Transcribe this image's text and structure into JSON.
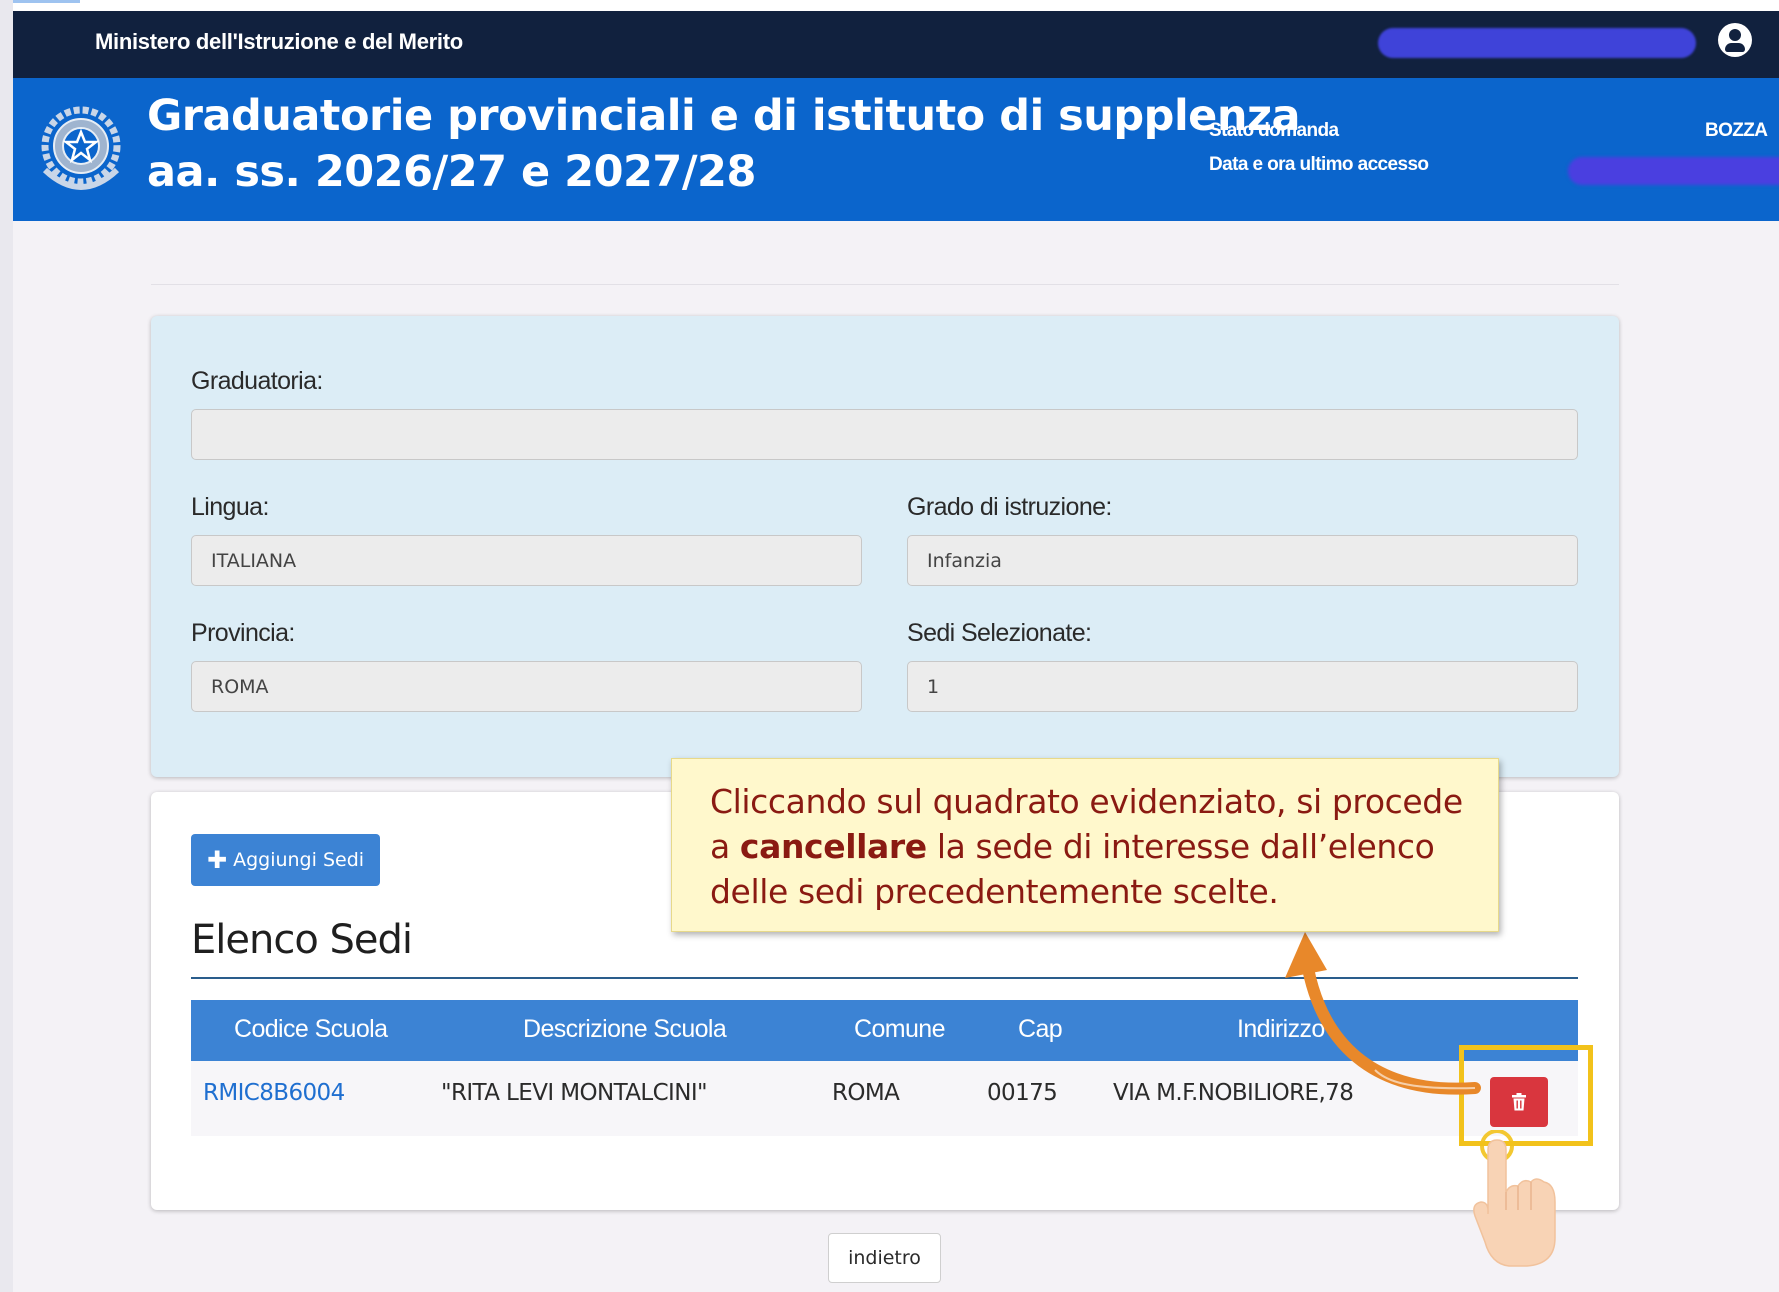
{
  "topbar": {
    "ministry": "Ministero dell'Istruzione e del Merito"
  },
  "header": {
    "title_line1": "Graduatorie provinciali e di istituto di supplenza",
    "title_line2": "aa. ss. 2026/27 e 2027/28",
    "stato_label": "Stato domanda",
    "stato_value": "BOZZA",
    "data_label": "Data e ora ultimo accesso"
  },
  "form": {
    "graduatoria_label": "Graduatoria:",
    "graduatoria_value": "",
    "lingua_label": "Lingua:",
    "lingua_value": "ITALIANA",
    "grado_label": "Grado di istruzione:",
    "grado_value": "Infanzia",
    "provincia_label": "Provincia:",
    "provincia_value": "ROMA",
    "sedi_label": "Sedi Selezionate:",
    "sedi_value": "1"
  },
  "list": {
    "add_button": "Aggiungi Sedi",
    "title": "Elenco Sedi",
    "columns": [
      "Codice Scuola",
      "Descrizione Scuola",
      "Comune",
      "Cap",
      "Indirizzo"
    ],
    "rows": [
      {
        "codice": "RMIC8B6004",
        "descrizione": "\"RITA LEVI MONTALCINI\"",
        "comune": "ROMA",
        "cap": "00175",
        "indirizzo": "VIA M.F.NOBILIORE,78"
      }
    ]
  },
  "footer": {
    "back_button": "indietro"
  },
  "callout": {
    "pre": "Cliccando sul quadrato evidenziato, si procede a",
    "bold": "cancellare",
    "post": "la sede di interesse dall’elenco delle sedi precedentemente scelte."
  },
  "colors": {
    "topbar": "#11213e",
    "header": "#0b65cc",
    "table_header": "#3c83d4",
    "delete": "#d9363e",
    "highlight": "#f2c21b",
    "callout_text": "#8a1a12",
    "arrow": "#e8882a"
  },
  "icons": {
    "user": "user-circle-icon",
    "emblem": "republic-emblem-icon",
    "add": "plus-icon",
    "delete": "trash-icon",
    "pointer": "hand-pointer-icon",
    "arrow": "curved-arrow-icon"
  }
}
